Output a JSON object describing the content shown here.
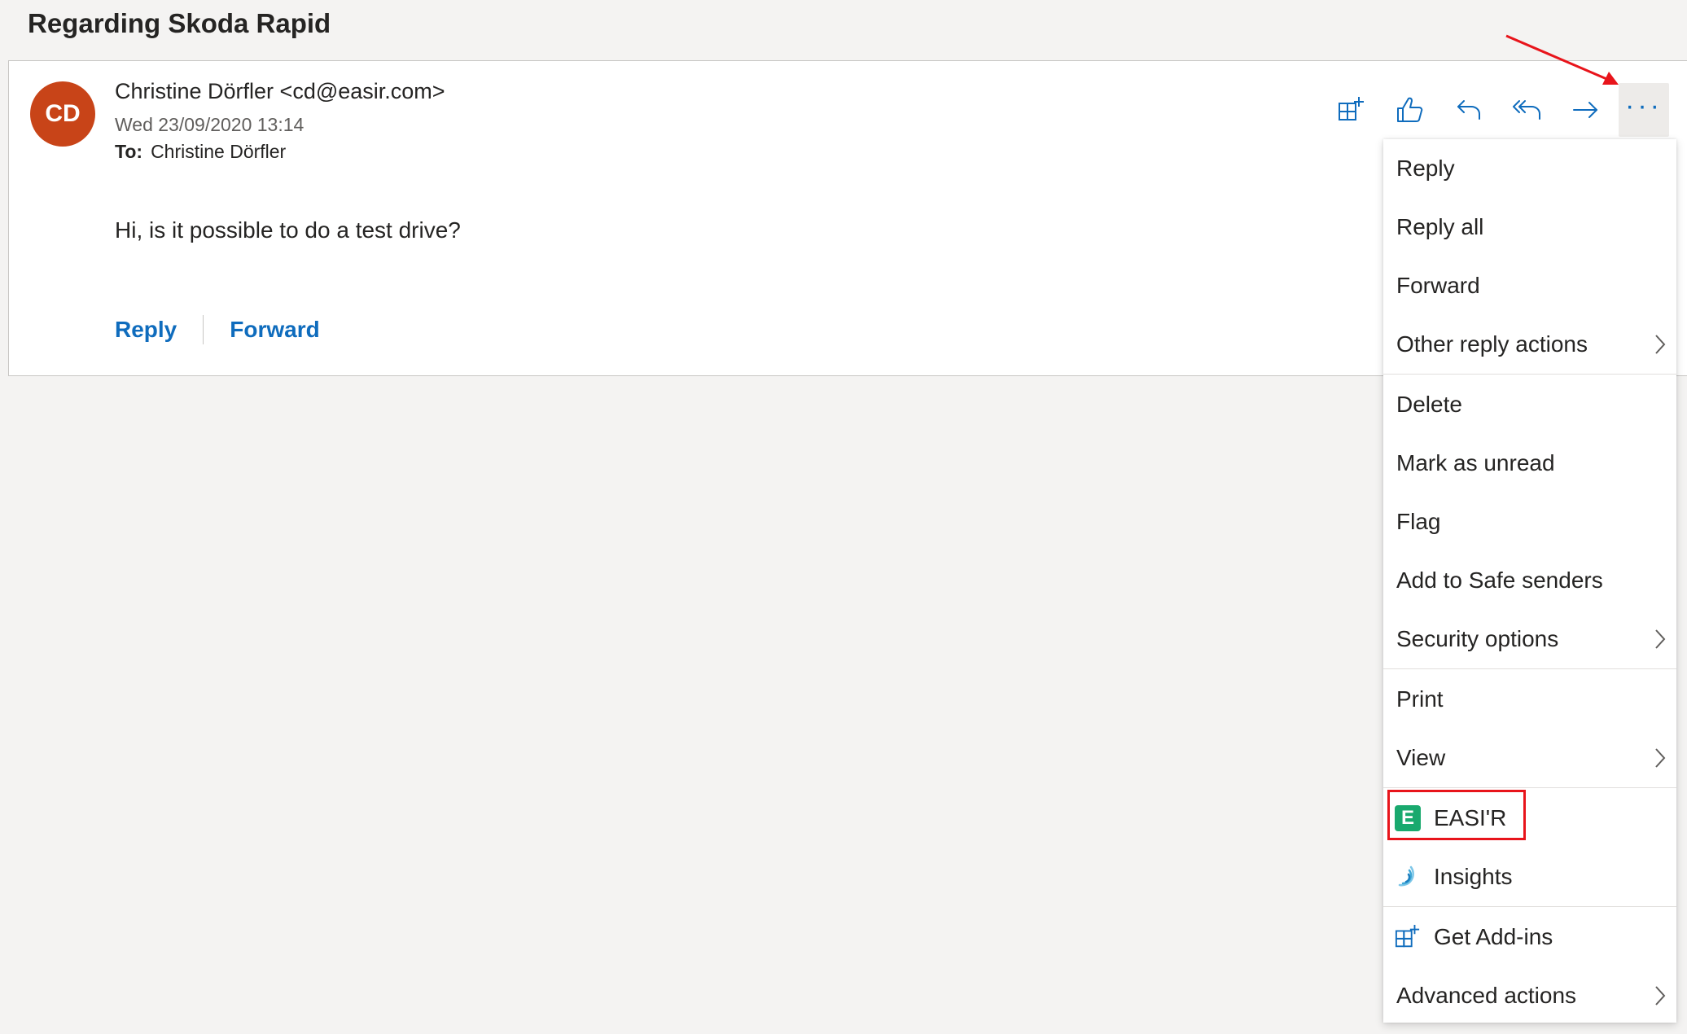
{
  "subject": "Regarding Skoda Rapid",
  "message": {
    "avatar_initials": "CD",
    "sender": "Christine Dörfler <cd@easir.com>",
    "date": "Wed 23/09/2020 13:14",
    "to_label": "To:",
    "to_value": "Christine Dörfler",
    "body": "Hi, is it possible to do a test drive?",
    "quick_reply": "Reply",
    "quick_forward": "Forward"
  },
  "toolbar": {
    "icons": [
      "add-ins-icon",
      "like-icon",
      "reply-icon",
      "reply-all-icon",
      "forward-icon",
      "more-actions-icon"
    ],
    "more_label": "···"
  },
  "menu": {
    "items": [
      {
        "label": "Reply"
      },
      {
        "label": "Reply all"
      },
      {
        "label": "Forward"
      },
      {
        "label": "Other reply actions",
        "submenu": true
      },
      {
        "label": "Delete"
      },
      {
        "label": "Mark as unread"
      },
      {
        "label": "Flag"
      },
      {
        "label": "Add to Safe senders"
      },
      {
        "label": "Security options",
        "submenu": true
      },
      {
        "label": "Print"
      },
      {
        "label": "View",
        "submenu": true
      },
      {
        "label": "EASI'R",
        "icon": "easir-logo-icon",
        "icon_letter": "E",
        "highlighted": true
      },
      {
        "label": "Insights",
        "icon": "insights-icon"
      },
      {
        "label": "Get Add-ins",
        "icon": "add-ins-icon"
      },
      {
        "label": "Advanced actions",
        "submenu": true
      }
    ]
  },
  "colors": {
    "accent": "#0f6cbd",
    "avatar": "#c84418",
    "highlight_box": "#e8141b",
    "easir_green": "#19a96e"
  }
}
